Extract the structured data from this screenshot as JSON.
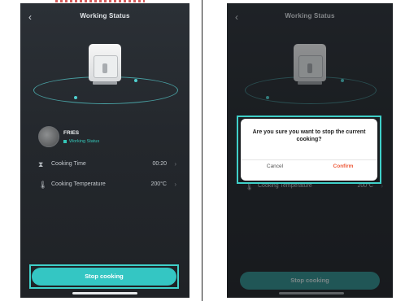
{
  "screens": {
    "left": {
      "title": "Working Status",
      "food": {
        "name": "FRIES",
        "status": "Working Status"
      },
      "rows": [
        {
          "icon": "hourglass-icon",
          "label": "Cooking Time",
          "value": "00:20"
        },
        {
          "icon": "thermometer-icon",
          "label": "Cooking Temperature",
          "value": "200°C"
        }
      ],
      "stop_button": "Stop cooking"
    },
    "right": {
      "title": "Working Status",
      "rows": [
        {
          "icon": "thermometer-icon",
          "label": "Cooking Temperature",
          "value": "200°C"
        }
      ],
      "dialog": {
        "message": "Are you sure you want to stop the current cooking?",
        "cancel": "Cancel",
        "confirm": "Confirm"
      },
      "stop_button": "Stop cooking"
    }
  },
  "colors": {
    "accent": "#34c6c3",
    "highlight": "#3fd0c9",
    "confirm": "#ee5a3a",
    "background": "#24282d"
  }
}
